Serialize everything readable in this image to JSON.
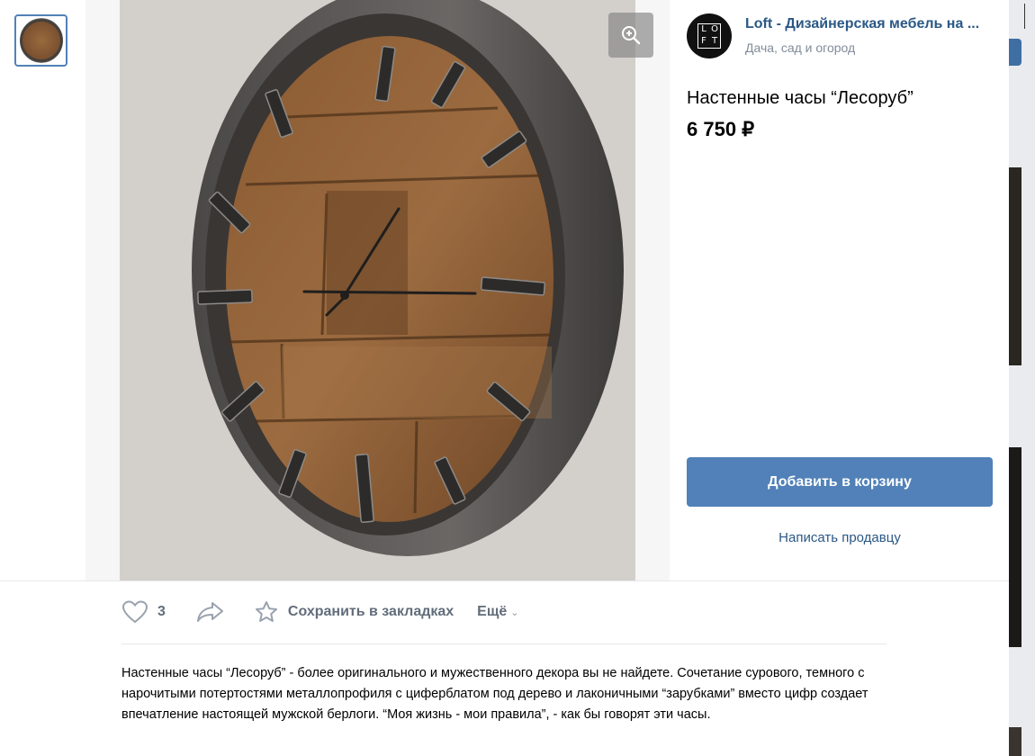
{
  "shop": {
    "name": "Loft - Дизайнерская мебель на ...",
    "category": "Дача, сад и огород",
    "logo_letters": [
      "L",
      "O",
      "F",
      "T"
    ]
  },
  "product": {
    "title": "Настенные часы “Лесоруб”",
    "price": "6 750 ₽",
    "description": "Настенные часы “Лесоруб” - более оригинального и мужественного декора вы не найдете. Сочетание сурового, темного с нарочитыми потертостями металлопрофиля с циферблатом под дерево и лаконичными “зарубками” вместо цифр создает впечатление настоящей мужской берлоги. “Моя жизнь - мои правила”, - как бы говорят эти часы."
  },
  "buttons": {
    "add_to_cart": "Добавить в корзину",
    "write_seller": "Написать продавцу"
  },
  "actions": {
    "likes_count": "3",
    "save_label": "Сохранить в закладках",
    "more_label": "Ещё"
  },
  "icons": {
    "zoom": "zoom-in-icon",
    "like": "heart-icon",
    "share": "share-arrow-icon",
    "save": "star-icon",
    "more": "chevron-down-icon"
  },
  "colors": {
    "accent": "#5181b8",
    "link": "#2a5885",
    "secondary_text": "#818c99"
  }
}
